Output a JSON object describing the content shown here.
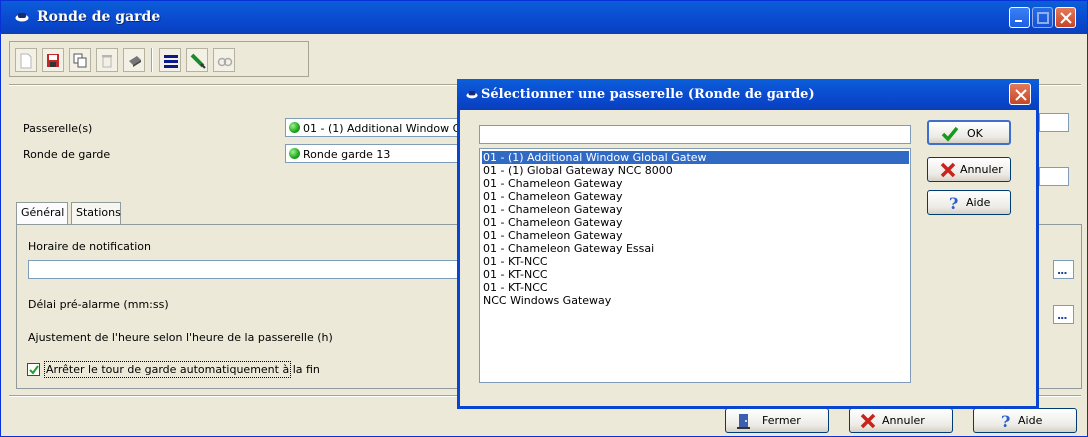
{
  "window": {
    "title": "Ronde de garde",
    "toolbar_icons": [
      "new-icon",
      "save-icon",
      "copy-icon",
      "delete-icon",
      "print-icon",
      "list-icon",
      "edit-icon",
      "find-icon"
    ]
  },
  "form": {
    "gateway_label": "Passerelle(s)",
    "gateway_value": "01 - (1)  Additional Window Glo",
    "round_label": "Ronde de garde",
    "round_value": "Ronde garde 13"
  },
  "tabs": [
    {
      "label": "Général",
      "active": true
    },
    {
      "label": "Stations",
      "active": false
    }
  ],
  "general": {
    "notification_label": "Horaire de notification",
    "notification_value": "",
    "prealarm_label": "Délai pré-alarme (mm:ss)",
    "adjust_label": "Ajustement de l'heure selon l'heure de la passerelle (h)",
    "stop_label": "Arrêter le tour de garde automatiquement à la fin",
    "stop_checked": true,
    "ellipsis": "..."
  },
  "footer": {
    "close_label": "Fermer",
    "cancel_label": "Annuler",
    "help_label": "Aide"
  },
  "dialog": {
    "title": "Sélectionner une passerelle (Ronde de garde)",
    "filter_value": "",
    "items": [
      "01 - (1)  Additional Window Global Gatew",
      "01 - (1)  Global Gateway NCC 8000",
      "01 - Chameleon Gateway",
      "01 - Chameleon Gateway",
      "01 - Chameleon Gateway",
      "01 - Chameleon Gateway",
      "01 - Chameleon Gateway",
      "01 - Chameleon Gateway Essai",
      "01 - KT-NCC",
      "01 - KT-NCC",
      "01 - KT-NCC",
      "NCC Windows Gateway"
    ],
    "selected_index": 0,
    "ok_label": "OK",
    "cancel_label": "Annuler",
    "help_label": "Aide"
  },
  "colors": {
    "titlebar": "#0b4fd3",
    "selection": "#316ac5",
    "window_bg": "#ece9d8",
    "ok_green": "#1a9a1a",
    "cancel_red": "#c8241b",
    "help_blue": "#2a5fc8"
  }
}
